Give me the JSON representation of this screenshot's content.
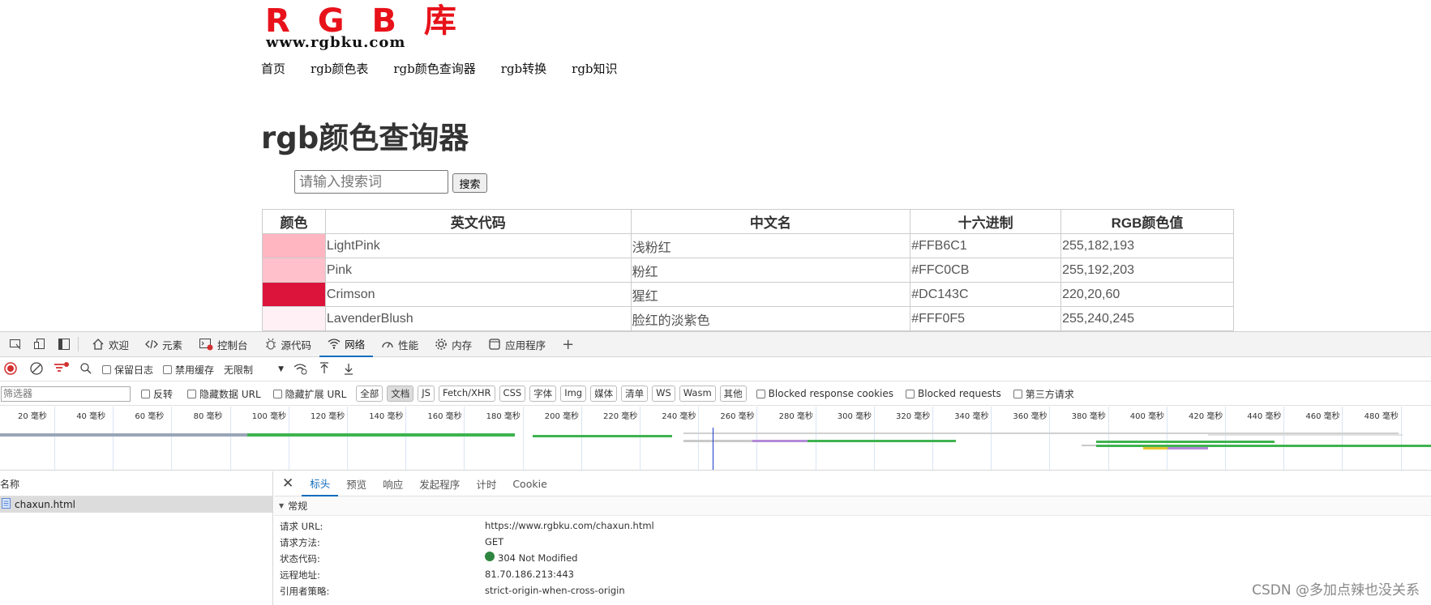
{
  "site": {
    "logo_title": "R G B 库",
    "logo_url": "www.rgbku.com",
    "nav": [
      "首页",
      "rgb颜色表",
      "rgb颜色查询器",
      "rgb转换",
      "rgb知识"
    ]
  },
  "main": {
    "title": "rgb颜色查询器",
    "search_placeholder": "请输入搜索词",
    "search_button": "搜索",
    "table": {
      "headers": [
        "颜色",
        "英文代码",
        "中文名",
        "十六进制",
        "RGB颜色值"
      ],
      "rows": [
        {
          "swatch": "#FFB6C1",
          "en": "LightPink",
          "cn": "浅粉红",
          "hex": "#FFB6C1",
          "rgb": "255,182,193"
        },
        {
          "swatch": "#FFC0CB",
          "en": "Pink",
          "cn": "粉红",
          "hex": "#FFC0CB",
          "rgb": "255,192,203"
        },
        {
          "swatch": "#DC143C",
          "en": "Crimson",
          "cn": "猩红",
          "hex": "#DC143C",
          "rgb": "220,20,60"
        },
        {
          "swatch": "#FFF0F5",
          "en": "LavenderBlush",
          "cn": "脸红的淡紫色",
          "hex": "#FFF0F5",
          "rgb": "255,240,245"
        }
      ]
    }
  },
  "devtools": {
    "tabs": [
      "欢迎",
      "元素",
      "控制台",
      "源代码",
      "网络",
      "性能",
      "内存",
      "应用程序"
    ],
    "active_tab": "网络",
    "toolbar": {
      "preserve_log": "保留日志",
      "disable_cache": "禁用缓存",
      "throttle": "无限制"
    },
    "filter": {
      "placeholder": "筛选器",
      "invert": "反转",
      "hide_data_url": "隐藏数据 URL",
      "hide_ext_url": "隐藏扩展 URL",
      "types": [
        "全部",
        "文档",
        "JS",
        "Fetch/XHR",
        "CSS",
        "字体",
        "Img",
        "媒体",
        "清单",
        "WS",
        "Wasm",
        "其他"
      ],
      "active_type": "文档",
      "blocked_cookies": "Blocked response cookies",
      "blocked_requests": "Blocked requests",
      "third_party": "第三方请求"
    },
    "timeline_ticks": [
      "20 毫秒",
      "40 毫秒",
      "60 毫秒",
      "80 毫秒",
      "100 毫秒",
      "120 毫秒",
      "140 毫秒",
      "160 毫秒",
      "180 毫秒",
      "200 毫秒",
      "220 毫秒",
      "240 毫秒",
      "260 毫秒",
      "280 毫秒",
      "300 毫秒",
      "320 毫秒",
      "340 毫秒",
      "360 毫秒",
      "380 毫秒",
      "400 毫秒",
      "420 毫秒",
      "440 毫秒",
      "460 毫秒",
      "480 毫秒"
    ],
    "requests": {
      "header": "名称",
      "items": [
        "chaxun.html"
      ]
    },
    "detail": {
      "tabs": [
        "标头",
        "预览",
        "响应",
        "发起程序",
        "计时",
        "Cookie"
      ],
      "active_tab": "标头",
      "section": "常规",
      "fields": [
        {
          "key": "请求 URL:",
          "value": "https://www.rgbku.com/chaxun.html"
        },
        {
          "key": "请求方法:",
          "value": "GET"
        },
        {
          "key": "状态代码:",
          "value": "304 Not Modified"
        },
        {
          "key": "远程地址:",
          "value": "81.70.186.213:443"
        },
        {
          "key": "引用者策略:",
          "value": "strict-origin-when-cross-origin"
        }
      ],
      "status_color": "#2e8540"
    }
  },
  "watermark": "CSDN @多加点辣也没关系"
}
